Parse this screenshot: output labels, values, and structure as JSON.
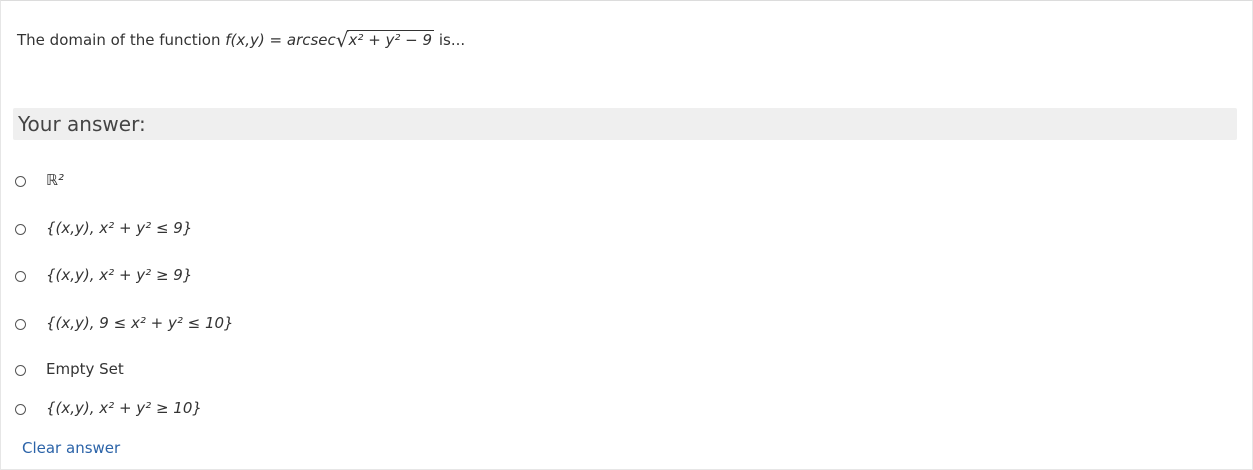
{
  "question": {
    "prefix": "The domain of the function ",
    "func": "f(x,y) = arcsec",
    "radicand": "x² + y² − 9",
    "suffix": " is..."
  },
  "answer_label": "Your answer:",
  "options": [
    {
      "text": "ℝ²",
      "selected": false
    },
    {
      "text": "{(x,y), x² + y² ≤ 9}",
      "selected": false
    },
    {
      "text": "{(x,y), x² + y² ≥ 9}",
      "selected": false
    },
    {
      "text": "{(x,y), 9 ≤ x² + y² ≤ 10}",
      "selected": false
    },
    {
      "text": "Empty Set",
      "selected": false
    },
    {
      "text": "{(x,y), x² + y² ≥ 10}",
      "selected": false
    }
  ],
  "clear_answer": "Clear answer",
  "colors": {
    "link": "#2b63a8",
    "band": "#efefef",
    "text": "#333333"
  }
}
